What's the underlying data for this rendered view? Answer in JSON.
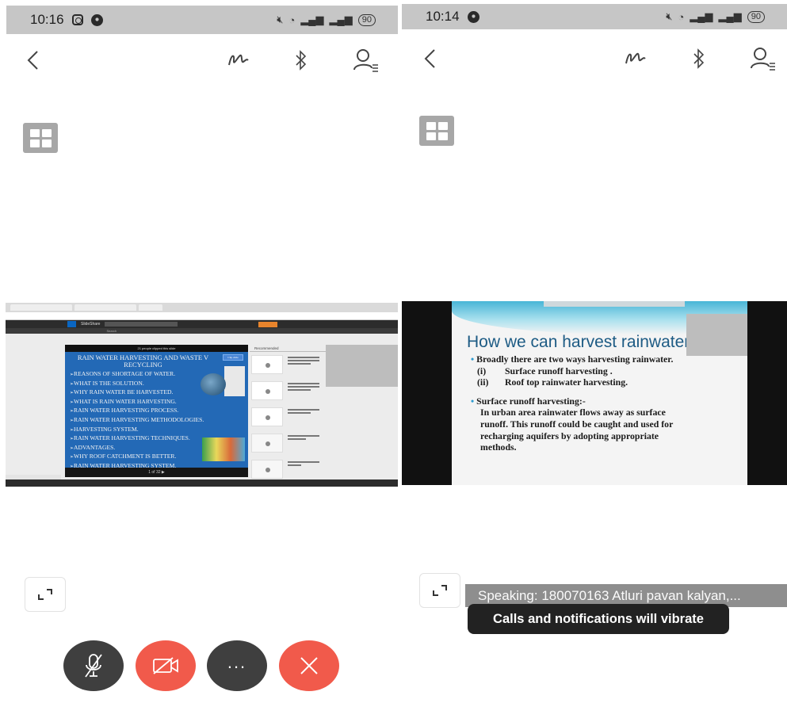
{
  "left_panel": {
    "status_time": "10:16",
    "battery": "90",
    "slide": {
      "header": "21 people clipped this slide",
      "title": "RAIN WATER HARVESTING AND WASTE V RECYCLING",
      "clip_label": "Clip slide",
      "items": [
        "REASONS OF SHORTAGE OF WATER.",
        "WHAT IS THE SOLUTION.",
        "WHY RAIN WATER BE HARVESTED.",
        "WHAT IS RAIN WATER HARVESTING.",
        "RAIN WATER HARVESTING PROCESS.",
        "RAIN WATER HARVESTING METHODOLOGIES.",
        "HARVESTING SYSTEM.",
        "RAIN WATER HARVESTING TECHNIQUES.",
        "ADVANTAGES.",
        "WHY ROOF CATCHMENT IS BETTER.",
        "RAIN WATER HARVESTING SYSTEM."
      ],
      "footer": "1 of 32"
    },
    "recommended_label": "Recommended",
    "brand": "SlideShare",
    "search_placeholder": "Search"
  },
  "right_panel": {
    "status_time": "10:14",
    "battery": "90",
    "slide": {
      "title": "How we can harvest rainwater?",
      "bullet1": "Broadly there are two ways harvesting  rainwater.",
      "sub1_num": "(i)",
      "sub1_text": "Surface runoff harvesting .",
      "sub2_num": "(ii)",
      "sub2_text": "Roof top rainwater harvesting.",
      "bullet2": "Surface runoff harvesting:-",
      "para_lines": [
        "In urban area rainwater flows away as surface",
        "runoff. This runoff could be caught and used for",
        "recharging aquifers by adopting appropriate",
        "methods."
      ]
    },
    "speaking_text": "Speaking: 180070163 Atluri pavan kalyan,...",
    "toast_text": "Calls and notifications will vibrate"
  },
  "controls": {
    "more_label": "..."
  },
  "colors": {
    "status_bar": "#c6c6c6",
    "end_call_red": "#f15a4b",
    "control_dark": "#3f3f3f",
    "slide_blue": "#2369b6",
    "title_blue": "#1d5b84"
  }
}
